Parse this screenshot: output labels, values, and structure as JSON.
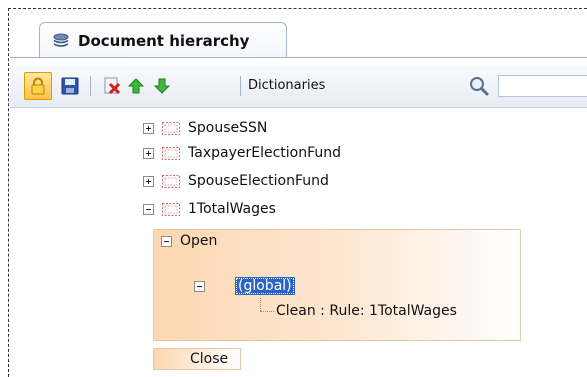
{
  "panel": {
    "tab_title": "Document hierarchy"
  },
  "toolbar": {
    "buttons": [
      {
        "name": "lock",
        "icon": "lock-icon",
        "active": true
      },
      {
        "name": "save",
        "icon": "save-icon"
      },
      {
        "name": "delete",
        "icon": "delete-icon"
      },
      {
        "name": "move-up",
        "icon": "arrow-up-icon"
      },
      {
        "name": "move-down",
        "icon": "arrow-down-icon"
      }
    ],
    "dictionaries_label": "Dictionaries",
    "search": {
      "value": "",
      "placeholder": ""
    }
  },
  "tree": {
    "items": [
      {
        "label": "SpouseSSN",
        "expanded": false
      },
      {
        "label": "TaxpayerElectionFund",
        "expanded": false
      },
      {
        "label": "SpouseElectionFund",
        "expanded": false
      },
      {
        "label": "1TotalWages",
        "expanded": true
      }
    ],
    "open_label": "Open",
    "global_label": "(global)",
    "rule_label": "Clean : Rule: 1TotalWages",
    "close_label": "Close"
  },
  "colors": {
    "accent_orange": "#ffc34d",
    "selection_blue": "#2b63c6",
    "section_fill": "#fbd7b0"
  }
}
